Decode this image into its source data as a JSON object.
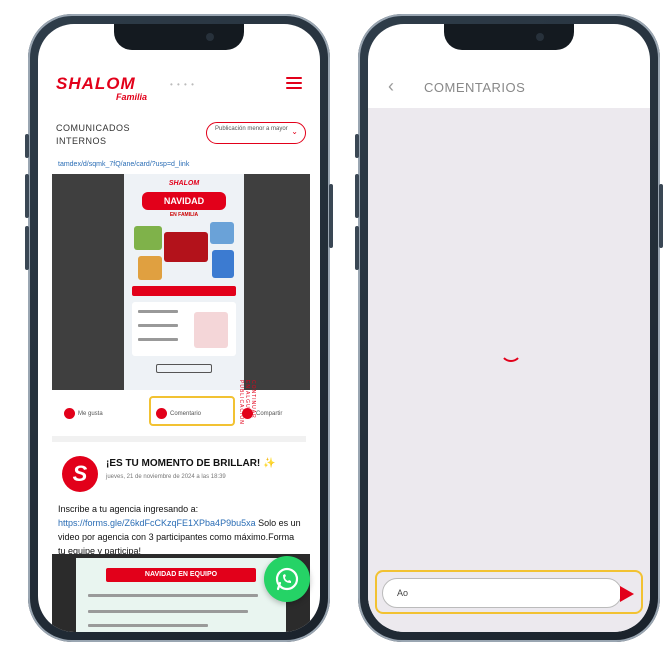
{
  "left": {
    "logo": "SHALOM",
    "logo_sub": "Familia",
    "logo_dots": "• • • •",
    "section_title": "COMUNICADOS INTERNOS",
    "filter": "Publicación menor a mayor",
    "link": "tamdex/d/sqmk_7fQ/ane/card/?usp=d_link",
    "poster": {
      "logo": "SHALOM",
      "title": "NAVIDAD",
      "subtitle": "EN FAMILIA"
    },
    "vertical_text": "CONTINUAR EN ALGUNA PUBLICACIÓN",
    "actions": [
      "Me gusta",
      "Comentario",
      "Compartir"
    ],
    "post": {
      "avatar_letter": "S",
      "title": "¡ES TU MOMENTO DE BRILLAR! ✨",
      "date": "jueves, 21 de noviembre de 2024 a las 18:39",
      "body_pre": "Inscribe a tu agencia ingresando a: ",
      "body_link": "https://forms.gle/Z6kdFcCKzqFE1XPba4P9bu5xa",
      "body_post": " Solo es un video por agencia con 3 participantes como máximo.Forma tu equipe y participa!"
    },
    "banner_title": "NAVIDAD EN EQUIPO"
  },
  "right": {
    "back_glyph": "‹",
    "title": "COMENTARIOS",
    "input_value": "Ao",
    "send_icon": "send-icon"
  },
  "colors": {
    "brand_red": "#e2001a",
    "highlight": "#f2c232",
    "whatsapp": "#25d366"
  }
}
